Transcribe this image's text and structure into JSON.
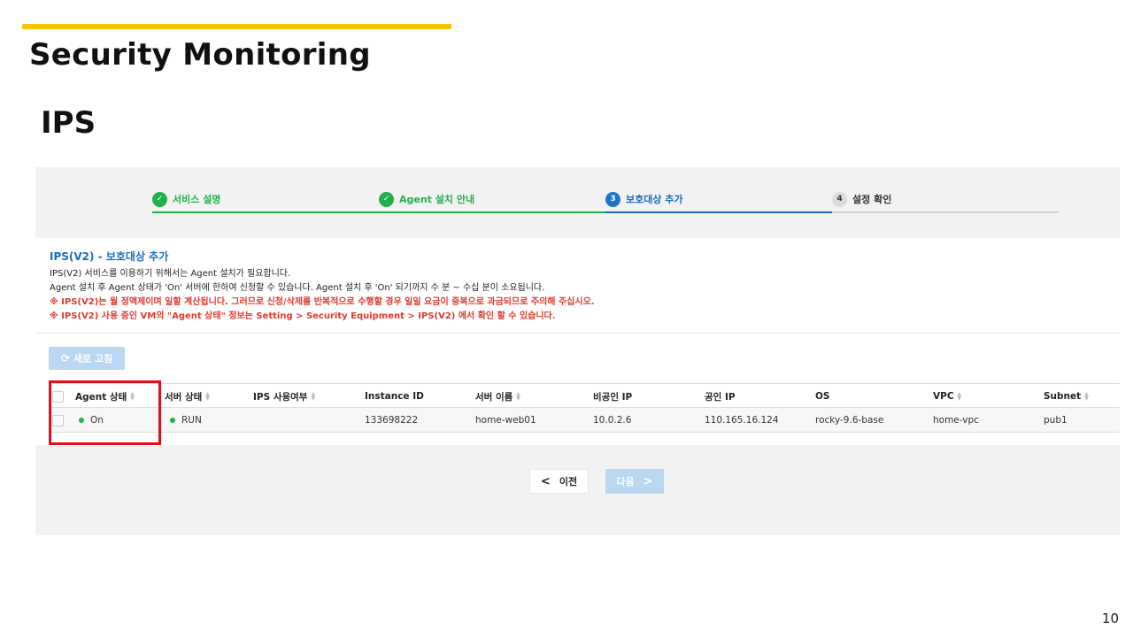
{
  "slide": {
    "title": "Security Monitoring",
    "section": "IPS",
    "page_number": "10"
  },
  "stepper": {
    "steps": [
      {
        "label": "서비스 설명",
        "state": "done",
        "marker": "✓"
      },
      {
        "label": "Agent 설치 안내",
        "state": "done",
        "marker": "✓"
      },
      {
        "label": "보호대상 추가",
        "state": "active",
        "marker": "3"
      },
      {
        "label": "설정 확인",
        "state": "todo",
        "marker": "4"
      }
    ]
  },
  "info": {
    "title": "IPS(V2) - 보호대상 추가",
    "lines": [
      "IPS(V2) 서비스를 이용하기 위해서는 Agent 설치가 필요합니다.",
      "Agent 설치 후 Agent 상태가 'On' 서버에 한하여 신청할 수 있습니다.  Agent 설치 후 'On' 되기까지 수 분 ~ 수십 분이 소요됩니다."
    ],
    "warnings": [
      "※ IPS(V2)는 월 정액제이며 일할 계산됩니다. 그러므로 신청/삭제를 반복적으로 수행할 경우 일일 요금이 중복으로 과금되므로 주의해 주십시오.",
      "※ IPS(V2) 사용 중인 VM의 \"Agent 상태\" 정보는 Setting > Security Equipment > IPS(V2) 에서 확인 할 수 있습니다."
    ]
  },
  "toolbar": {
    "refresh_label": "새로 고침"
  },
  "table": {
    "headers": [
      "Agent 상태",
      "서버 상태",
      "IPS 사용여부",
      "Instance ID",
      "서버 이름",
      "비공인 IP",
      "공인 IP",
      "OS",
      "VPC",
      "Subnet"
    ],
    "rows": [
      {
        "agent_status": "On",
        "server_status": "RUN",
        "ips_usage": "",
        "instance_id": "133698222",
        "server_name": "home-web01",
        "private_ip": "10.0.2.6",
        "public_ip": "110.165.16.124",
        "os": "rocky-9.6-base",
        "vpc": "home-vpc",
        "subnet": "pub1"
      }
    ]
  },
  "nav": {
    "prev_label": "이전",
    "next_label": "다음"
  },
  "colors": {
    "accent": "#f5c400",
    "done": "#21b04b",
    "active": "#1b6cbf",
    "warning": "#e03a2f",
    "highlight": "#e0101a"
  }
}
